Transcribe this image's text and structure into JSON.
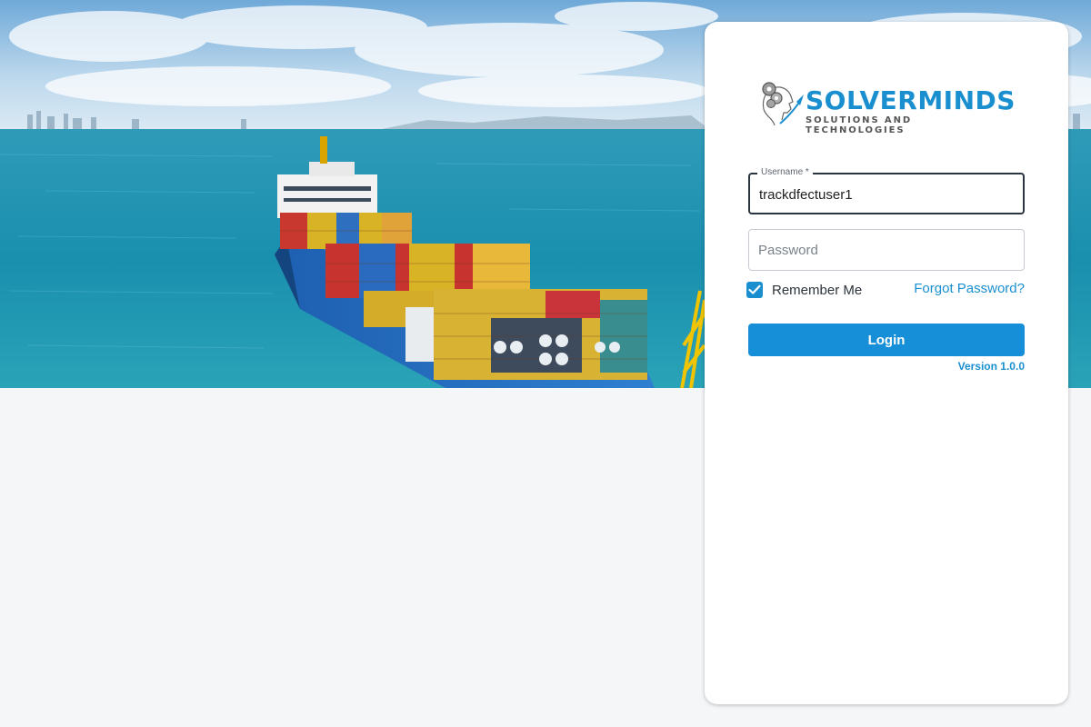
{
  "brand": {
    "name": "SOLVERMINDS",
    "tagline": "SOLUTIONS AND TECHNOLOGIES",
    "logo_icon": "gear-head-icon",
    "accent_color": "#1a8fd0"
  },
  "login_form": {
    "username": {
      "label": "Username *",
      "value": "trackdfectuser1"
    },
    "password": {
      "placeholder": "Password",
      "value": ""
    },
    "remember_me": {
      "label": "Remember Me",
      "checked": true
    },
    "forgot_password_label": "Forgot Password?",
    "login_button_label": "Login",
    "version": "Version 1.0.0"
  },
  "hero": {
    "image_icon": "container-ship-photo"
  }
}
